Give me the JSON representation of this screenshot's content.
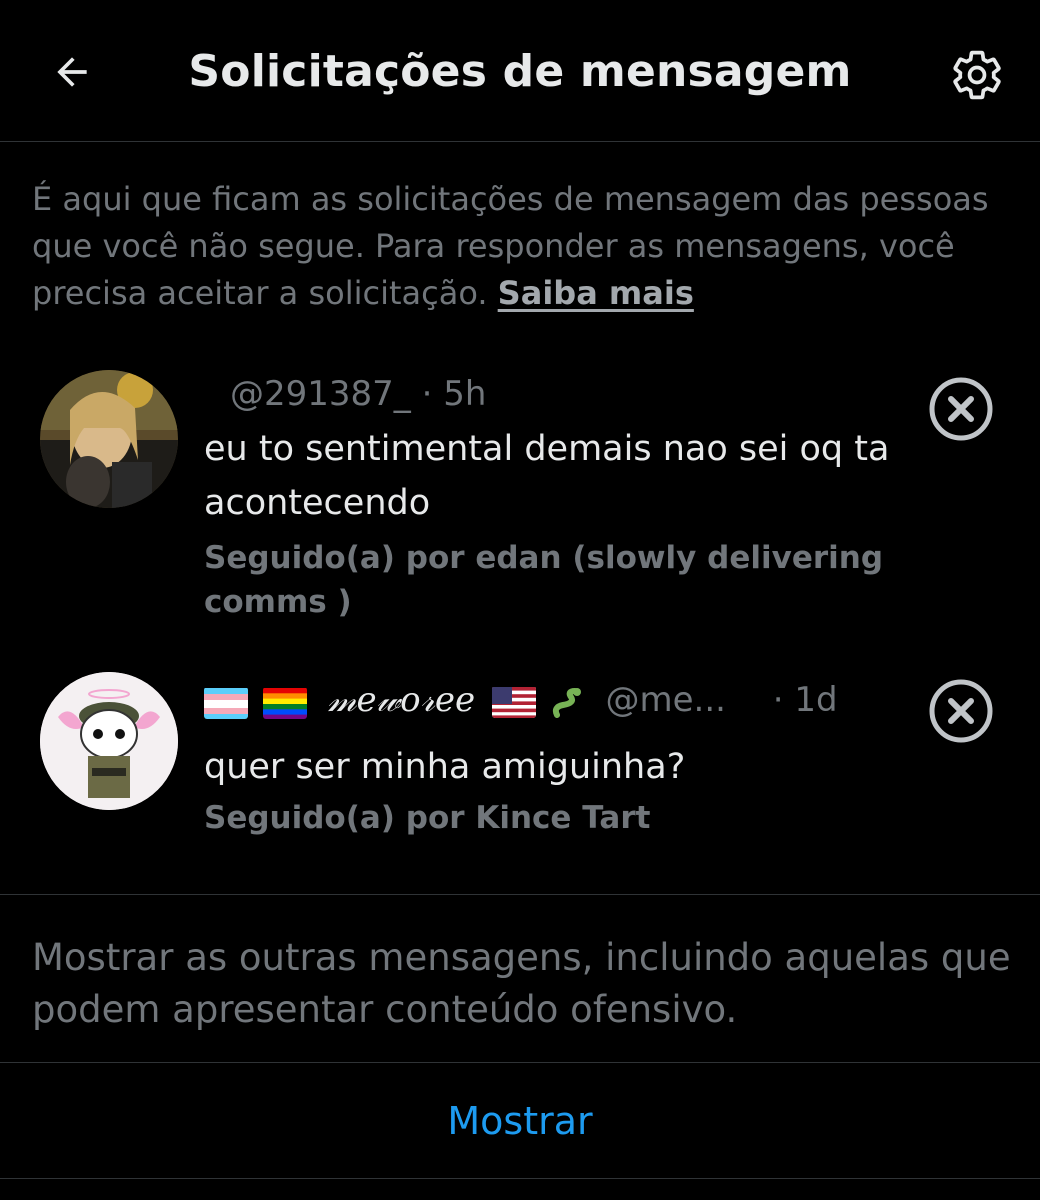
{
  "header": {
    "title": "Solicitações de mensagem",
    "back_icon": "arrow-left-icon",
    "settings_icon": "gear-icon"
  },
  "info": {
    "text": "É aqui que ficam as solicitações de mensagem das pessoas que você não segue. Para responder as mensagens, você precisa aceitar a solicitação.",
    "link_label": "Saiba mais"
  },
  "requests": [
    {
      "name": "",
      "handle": "@291387_",
      "time": "· 5h",
      "message": "eu to sentimental demais nao sei oq ta acontecendo",
      "followed_by": "Seguido(a) por  edan  (slowly delivering comms )",
      "dismiss_icon": "close-circle-icon"
    },
    {
      "name": "𝓂𝑒𝓌𝑜𝓇𝑒𝑒",
      "handle": "@me...",
      "time": "· 1d",
      "message": "quer ser minha amiguinha?",
      "followed_by": "Seguido(a) por Kince Tart",
      "dismiss_icon": "close-circle-icon"
    }
  ],
  "footer": {
    "show_other_text": "Mostrar as outras mensagens, incluindo aquelas que podem apresentar conteúdo ofensivo.",
    "show_button": "Mostrar"
  },
  "colors": {
    "background": "#000000",
    "text_primary": "#e7e9ea",
    "text_secondary": "#71767b",
    "accent": "#1d9bf0",
    "divider": "#2f3336"
  }
}
